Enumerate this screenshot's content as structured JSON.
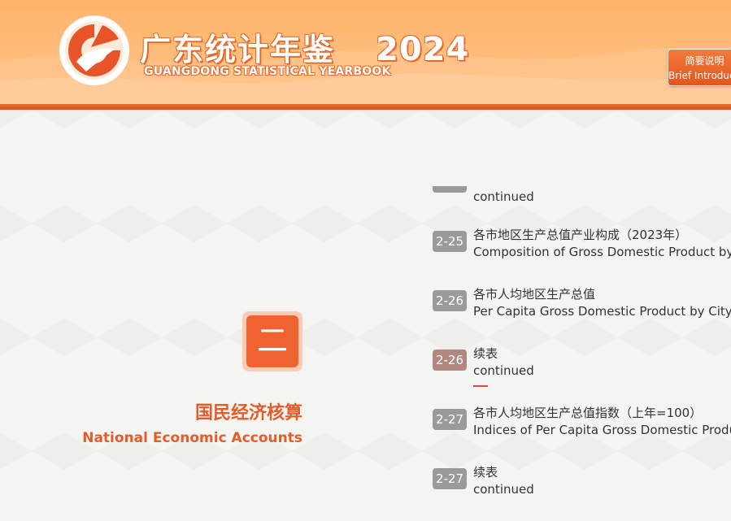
{
  "header": {
    "title_cn": "广东统计年鉴",
    "title_en": "GUANGDONG STATISTICAL YEARBOOK",
    "year": "2024",
    "brief_button": {
      "line1": "简要说明",
      "line2": "Brief Introduction"
    },
    "colors": {
      "primary": "#f06a2e",
      "light": "#ffbd7c"
    }
  },
  "chapter": {
    "number": "二",
    "title_cn": "国民经济核算",
    "title_en": "National Economic Accounts",
    "color": "#e25d2a"
  },
  "toc": {
    "top_continued": "continued",
    "items": [
      {
        "num": "2-25",
        "cn": "各市地区生产总值产业构成（2023年）",
        "en": "Composition of Gross Domestic Product by Industry"
      },
      {
        "num": "2-26",
        "cn": "各市人均地区生产总值",
        "en": "Per Capita Gross Domestic Product by City"
      },
      {
        "num": "2-26",
        "cn": "续表",
        "en": "continued",
        "active": true
      },
      {
        "num": "2-27",
        "cn": "各市人均地区生产总值指数（上年=100）",
        "en": "Indices of Per Capita Gross Domestic Product by City"
      },
      {
        "num": "2-27",
        "cn": "续表",
        "en": "continued"
      }
    ]
  }
}
